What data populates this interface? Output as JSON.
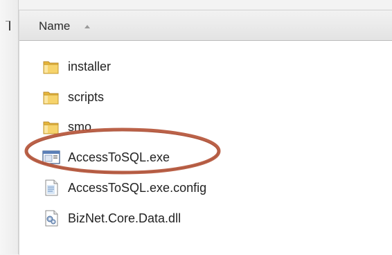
{
  "header": {
    "name_column": "Name"
  },
  "files": [
    {
      "label": "installer",
      "type": "folder"
    },
    {
      "label": "scripts",
      "type": "folder"
    },
    {
      "label": "smo",
      "type": "folder"
    },
    {
      "label": "AccessToSQL.exe",
      "type": "application"
    },
    {
      "label": "AccessToSQL.exe.config",
      "type": "config-file"
    },
    {
      "label": "BizNet.Core.Data.dll",
      "type": "dll-file"
    }
  ],
  "highlight": {
    "target": "AccessToSQL.exe",
    "color": "#b5553a"
  },
  "colors": {
    "folder_yellow": "#f2c94c",
    "header_bg": "#e8e8e8",
    "list_bg": "#ffffff"
  }
}
